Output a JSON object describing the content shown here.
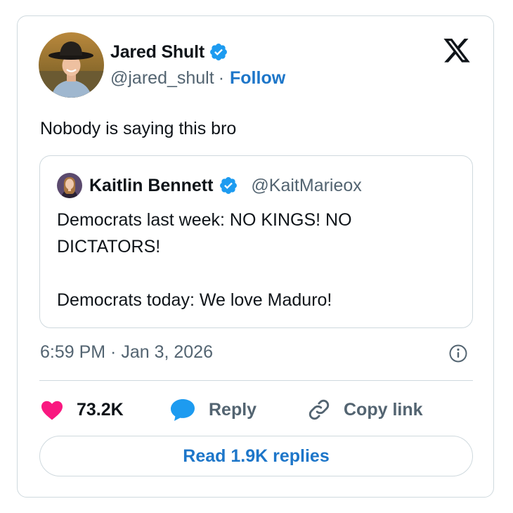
{
  "author": {
    "name": "Jared Shult",
    "handle": "@jared_shult",
    "separator": "·",
    "follow_label": "Follow",
    "verified": true,
    "verified_color": "#1d9bf0"
  },
  "tweet": {
    "text": "Nobody is saying this bro",
    "timestamp": "6:59 PM · Jan 3, 2026"
  },
  "quoted": {
    "name": "Kaitlin Bennett",
    "handle": "@KaitMarieox",
    "verified": true,
    "lines": [
      "Democrats last week: NO KINGS! NO DICTATORS!",
      "Democrats today: We love Maduro!"
    ]
  },
  "actions": {
    "like_count": "73.2K",
    "reply_label": "Reply",
    "copy_link_label": "Copy link",
    "like_color": "#f91880",
    "reply_color": "#1d9bf0"
  },
  "read_replies_label": "Read 1.9K replies",
  "icons": {
    "brand": "x-logo-icon",
    "verified": "verified-badge-icon",
    "info": "info-icon",
    "like": "heart-icon",
    "reply": "speech-bubble-icon",
    "copy": "link-icon"
  },
  "colors": {
    "link_blue": "#1d76c9",
    "muted": "#536471",
    "border": "#cfd9de"
  }
}
